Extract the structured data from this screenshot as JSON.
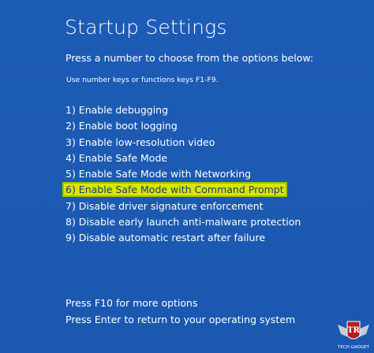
{
  "window": {
    "title": "Startup Settings",
    "instruction": "Press a number to choose from the options below:",
    "hint": "Use number keys or functions keys F1-F9."
  },
  "options": [
    {
      "label": "1) Enable debugging"
    },
    {
      "label": "2) Enable boot logging"
    },
    {
      "label": "3) Enable low-resolution video"
    },
    {
      "label": "4) Enable Safe Mode"
    },
    {
      "label": "5) Enable Safe Mode with Networking"
    },
    {
      "label": "6) Enable Safe Mode with Command Prompt",
      "highlighted": true
    },
    {
      "label": "7) Disable driver signature enforcement"
    },
    {
      "label": "8) Disable early launch anti-malware protection"
    },
    {
      "label": "9) Disable automatic restart after failure"
    }
  ],
  "footer": {
    "more_options": "Press F10 for more options",
    "return": "Press Enter to return to your operating system"
  },
  "watermark": {
    "monogram": "TR",
    "caption": "TECH GADGET"
  },
  "colors": {
    "background": "#1c5ab3",
    "text": "#ffffff",
    "highlight": "#d8e600",
    "highlight_text": "#1a3c7a"
  }
}
